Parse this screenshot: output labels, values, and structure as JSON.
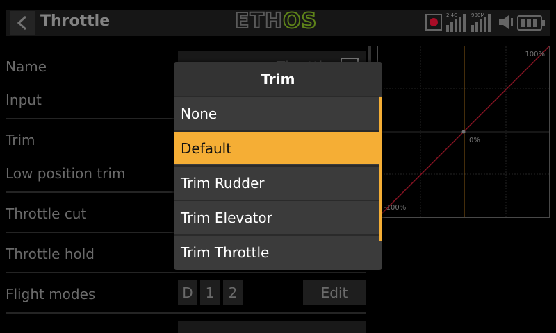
{
  "header": {
    "title": "Throttle",
    "logo_part1": "ETH",
    "logo_part2": "OS",
    "signal_2g4": "2.4G",
    "signal_900m": "900M"
  },
  "form": {
    "rows": [
      {
        "label": "Name"
      },
      {
        "label": "Input"
      },
      {
        "label": "Trim"
      },
      {
        "label": "Low position trim"
      },
      {
        "label": "Throttle cut"
      },
      {
        "label": "Throttle hold"
      },
      {
        "label": "Flight modes"
      }
    ],
    "name_value": "Throttle",
    "flight_mode_buttons": [
      "D",
      "1",
      "2"
    ],
    "edit_label": "Edit"
  },
  "graph": {
    "top_label": "100%",
    "center_label": "0%",
    "bottom_label": "-100%"
  },
  "dialog": {
    "title": "Trim",
    "options": [
      "None",
      "Default",
      "Trim Rudder",
      "Trim Elevator",
      "Trim Throttle"
    ],
    "selected": "Default"
  },
  "colors": {
    "accent": "#f5ae35",
    "logo_green": "#6f9a1e",
    "curve": "#a0182a"
  }
}
